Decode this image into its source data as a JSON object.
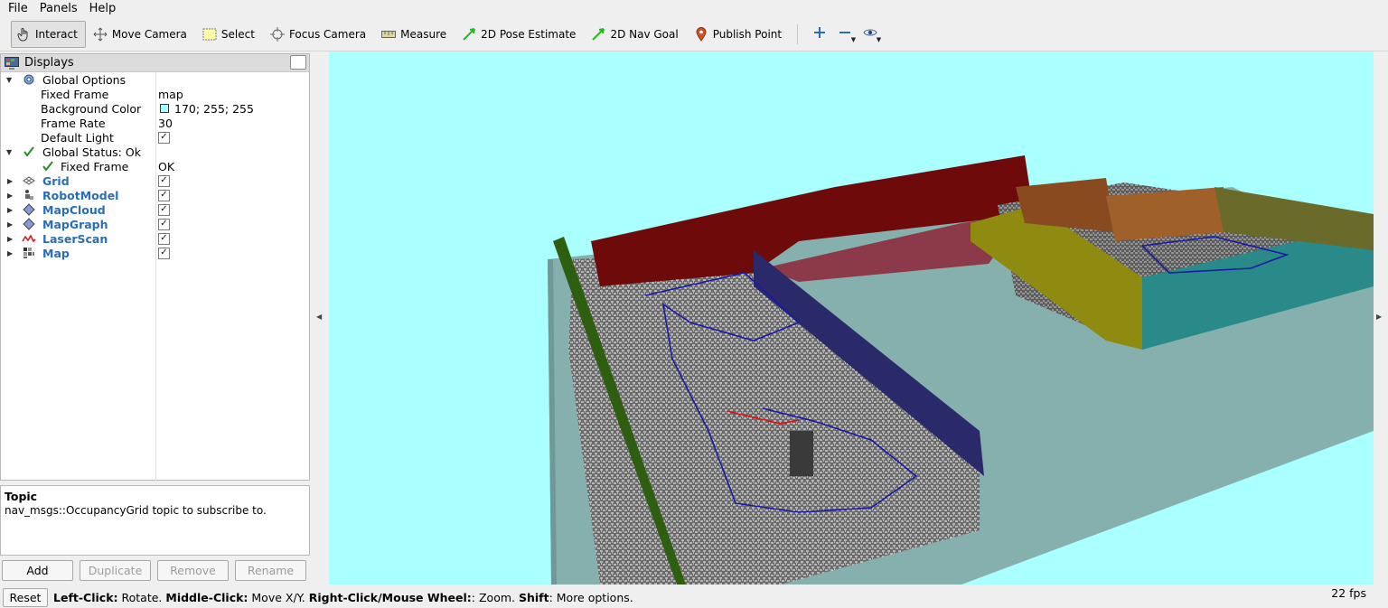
{
  "menu": {
    "file": "File",
    "panels": "Panels",
    "help": "Help"
  },
  "toolbar": {
    "interact": "Interact",
    "move_camera": "Move Camera",
    "select": "Select",
    "focus_camera": "Focus Camera",
    "measure": "Measure",
    "pose_estimate": "2D Pose Estimate",
    "nav_goal": "2D Nav Goal",
    "publish_point": "Publish Point"
  },
  "displays": {
    "title": "Displays",
    "global_options": {
      "label": "Global Options",
      "fixed_frame_label": "Fixed Frame",
      "fixed_frame_value": "map",
      "background_color_label": "Background Color",
      "background_color_value": "170; 255; 255",
      "background_color_hex": "#aaffff",
      "frame_rate_label": "Frame Rate",
      "frame_rate_value": "30",
      "default_light_label": "Default Light",
      "default_light_checked": true
    },
    "global_status": {
      "label": "Global Status: Ok",
      "fixed_frame_label": "Fixed Frame",
      "fixed_frame_value": "OK"
    },
    "items": [
      {
        "label": "Grid",
        "icon": "grid-icon",
        "checked": true
      },
      {
        "label": "RobotModel",
        "icon": "robot-model-icon",
        "checked": true
      },
      {
        "label": "MapCloud",
        "icon": "map-cloud-icon",
        "checked": true
      },
      {
        "label": "MapGraph",
        "icon": "map-graph-icon",
        "checked": true
      },
      {
        "label": "LaserScan",
        "icon": "laser-scan-icon",
        "checked": true
      },
      {
        "label": "Map",
        "icon": "map-icon",
        "checked": true
      }
    ]
  },
  "topic": {
    "title": "Topic",
    "description": "nav_msgs::OccupancyGrid topic to subscribe to."
  },
  "buttons": {
    "add": "Add",
    "duplicate": "Duplicate",
    "remove": "Remove",
    "rename": "Rename"
  },
  "statusbar": {
    "reset": "Reset",
    "left_click_key": "Left-Click:",
    "left_click_text": " Rotate. ",
    "middle_click_key": "Middle-Click:",
    "middle_click_text": " Move X/Y. ",
    "right_click_key": "Right-Click/Mouse Wheel:",
    "right_click_text": ": Zoom. ",
    "shift_key": "Shift",
    "shift_text": ": More options.",
    "fps": "22 fps"
  },
  "colors": {
    "viewport_background": "#aaffff",
    "link_blue": "#2a6db5"
  }
}
